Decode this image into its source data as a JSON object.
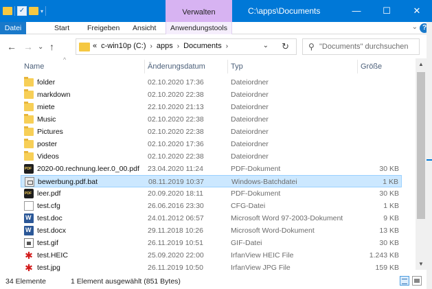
{
  "titlebar": {
    "context_tab": "Verwalten",
    "title": "C:\\apps\\Documents",
    "minimize": "—",
    "maximize": "☐",
    "close": "✕"
  },
  "ribbon": {
    "tabs": [
      "Datei",
      "Start",
      "Freigeben",
      "Ansicht",
      "Anwendungstools"
    ],
    "expand": "⌄",
    "help": "?"
  },
  "address": {
    "back": "←",
    "forward": "→",
    "recent": "⌄",
    "up": "↑",
    "overflow": "«",
    "crumbs": [
      "c-win10p (C:)",
      "apps",
      "Documents"
    ],
    "crumb_sep": "›",
    "dropdown": "⌄",
    "refresh": "↻"
  },
  "search": {
    "icon": "search-icon",
    "placeholder": "\"Documents\" durchsuchen"
  },
  "columns": {
    "name": "Name",
    "date": "Änderungsdatum",
    "type": "Typ",
    "size": "Größe",
    "sort": "^"
  },
  "files": [
    {
      "name": "folder",
      "date": "02.10.2020 17:36",
      "type": "Dateiordner",
      "size": "",
      "icon": "folder-icon"
    },
    {
      "name": "markdown",
      "date": "02.10.2020 22:38",
      "type": "Dateiordner",
      "size": "",
      "icon": "folder-icon"
    },
    {
      "name": "miete",
      "date": "22.10.2020 21:13",
      "type": "Dateiordner",
      "size": "",
      "icon": "folder-icon"
    },
    {
      "name": "Music",
      "date": "02.10.2020 22:38",
      "type": "Dateiordner",
      "size": "",
      "icon": "folder-icon"
    },
    {
      "name": "Pictures",
      "date": "02.10.2020 22:38",
      "type": "Dateiordner",
      "size": "",
      "icon": "folder-icon"
    },
    {
      "name": "poster",
      "date": "02.10.2020 17:36",
      "type": "Dateiordner",
      "size": "",
      "icon": "folder-icon"
    },
    {
      "name": "Videos",
      "date": "02.10.2020 22:38",
      "type": "Dateiordner",
      "size": "",
      "icon": "folder-icon"
    },
    {
      "name": "2020-00.rechnung.leer.0_00.pdf",
      "date": "23.04.2020 11:24",
      "type": "PDF-Dokument",
      "size": "30 KB",
      "icon": "pdf-icon"
    },
    {
      "name": "bewerbung.pdf.bat",
      "date": "08.11.2019 10:37",
      "type": "Windows-Batchdatei",
      "size": "1 KB",
      "icon": "batch-file-icon"
    },
    {
      "name": "leer.pdf",
      "date": "20.09.2020 18:11",
      "type": "PDF-Dokument",
      "size": "30 KB",
      "icon": "pdf-icon"
    },
    {
      "name": "test.cfg",
      "date": "26.06.2016 23:30",
      "type": "CFG-Datei",
      "size": "1 KB",
      "icon": "document-icon"
    },
    {
      "name": "test.doc",
      "date": "24.01.2012 06:57",
      "type": "Microsoft Word 97-2003-Dokument",
      "size": "9 KB",
      "icon": "word-icon"
    },
    {
      "name": "test.docx",
      "date": "29.11.2018 10:26",
      "type": "Microsoft Word-Dokument",
      "size": "13 KB",
      "icon": "word-icon"
    },
    {
      "name": "test.gif",
      "date": "26.11.2019 10:51",
      "type": "GIF-Datei",
      "size": "30 KB",
      "icon": "image-icon"
    },
    {
      "name": "test.HEIC",
      "date": "25.09.2020 22:00",
      "type": "IrfanView HEIC File",
      "size": "1.243 KB",
      "icon": "irfanview-icon"
    },
    {
      "name": "test.jpg",
      "date": "26.11.2019 10:50",
      "type": "IrfanView JPG File",
      "size": "159 KB",
      "icon": "irfanview-icon"
    }
  ],
  "status": {
    "count": "34 Elemente",
    "selection": "1 Element ausgewählt (851 Bytes)"
  }
}
